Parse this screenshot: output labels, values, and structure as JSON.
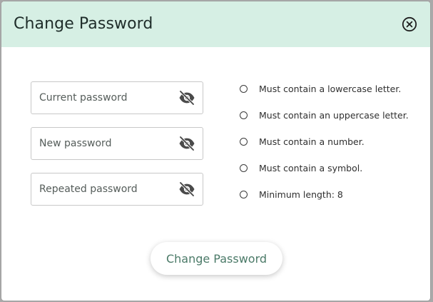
{
  "dialog": {
    "title": "Change Password",
    "close_icon": "close-circle-icon"
  },
  "form": {
    "fields": [
      {
        "id": "current",
        "placeholder": "Current password",
        "value": "",
        "toggle_icon": "eye-slash-icon"
      },
      {
        "id": "new",
        "placeholder": "New password",
        "value": "",
        "toggle_icon": "eye-slash-icon"
      },
      {
        "id": "repeated",
        "placeholder": "Repeated password",
        "value": "",
        "toggle_icon": "eye-slash-icon"
      }
    ],
    "submit_label": "Change Password"
  },
  "requirements": [
    {
      "label": "Must contain a lowercase letter.",
      "met": false
    },
    {
      "label": "Must contain an uppercase letter.",
      "met": false
    },
    {
      "label": "Must contain a number.",
      "met": false
    },
    {
      "label": "Must contain a symbol.",
      "met": false
    },
    {
      "label": "Minimum length: 8",
      "met": false
    }
  ],
  "colors": {
    "header_bg": "#d6efe4",
    "button_text": "#4b7a68",
    "field_border": "#c8c8c8"
  }
}
